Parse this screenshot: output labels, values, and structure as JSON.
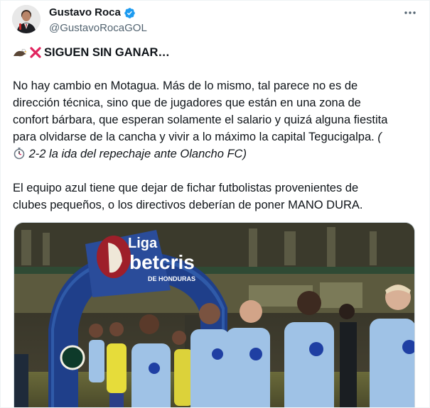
{
  "author": {
    "display_name": "Gustavo Roca",
    "handle": "@GustavoRocaGOL",
    "verified_color": "#1d9bf0"
  },
  "tweet": {
    "headline": "SIGUEN SIN GANAR…",
    "headline_icons": [
      "eagle-icon",
      "red-x-icon"
    ],
    "p1_lines": [
      "No hay cambio en Motagua. Más de lo mismo, tal parece no es de",
      "dirección técnica, sino que de jugadores que están en una zona de",
      "confort bárbara, que esperan solamente el salario y quizá alguna fiestita",
      "para olvidarse de la cancha y vivir a lo máximo la capital Tegucigalpa."
    ],
    "p1_italic_open": "(",
    "p1_italic_rest": "2-2 la ida del repechaje ante Olancho FC)",
    "p1_italic_icon": "stopwatch-icon",
    "p2_lines": [
      "El equipo azul tiene que dejar de fichar futbolistas provenientes de",
      "clubes pequeños, o los directivos deberían de poner MANO DURA."
    ]
  },
  "media": {
    "arch_text_top": "Liga",
    "arch_text_brand": "betcris",
    "arch_text_sub": "DE HONDURAS",
    "jersey_color": "#9fc2e6",
    "arch_color": "#1f3f8a"
  },
  "colors": {
    "text": "#0f1419",
    "secondary": "#536471",
    "accent": "#1d9bf0",
    "x_red": "#e0245e"
  }
}
